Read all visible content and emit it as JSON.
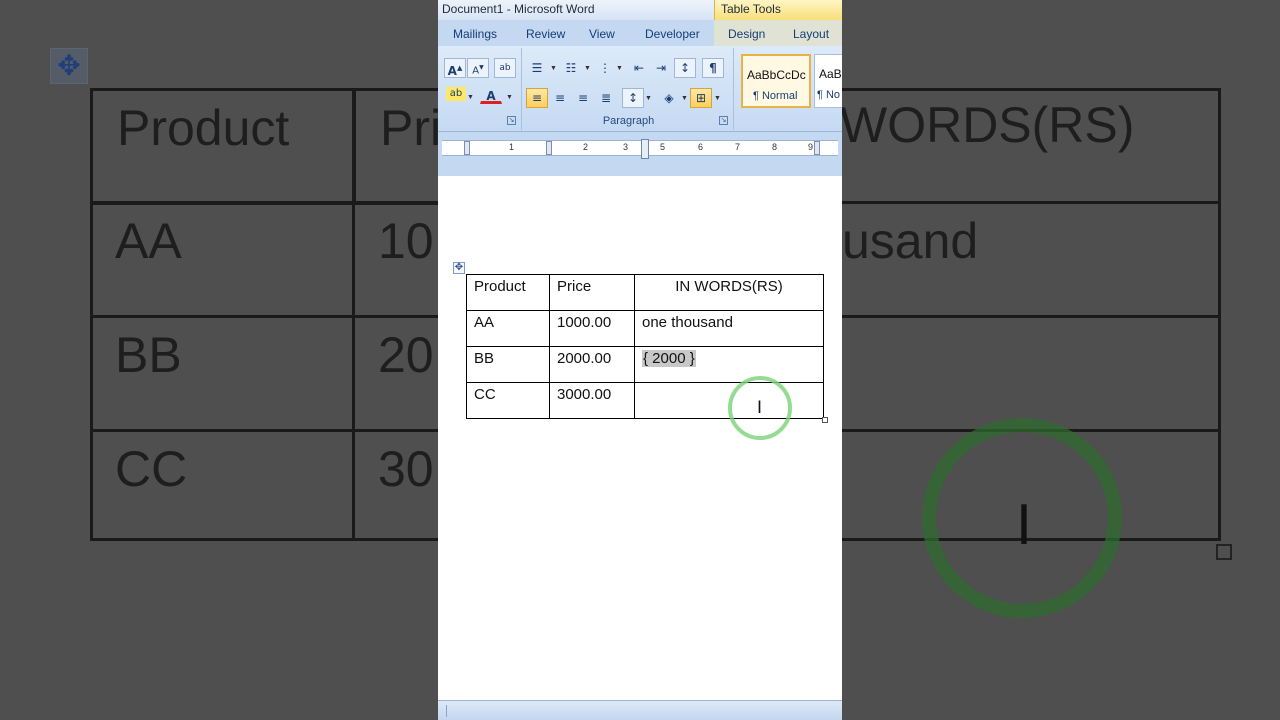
{
  "window": {
    "title": "Document1 - Microsoft Word",
    "context_label": "Table Tools"
  },
  "tabs": [
    {
      "label": "Mailings"
    },
    {
      "label": "Review"
    },
    {
      "label": "View"
    },
    {
      "label": "Developer"
    },
    {
      "label": "Design"
    },
    {
      "label": "Layout"
    }
  ],
  "ribbon": {
    "font_group": {
      "grow_font": "A",
      "shrink_font": "A",
      "clear_format": "ab",
      "highlight": "ab",
      "font_color": "A"
    },
    "paragraph_group": {
      "label": "Paragraph",
      "show_marks": "¶"
    },
    "styles": [
      {
        "sample": "AaBbCcDc",
        "name": "¶ Normal"
      },
      {
        "sample": "AaBl",
        "name": "¶ No"
      }
    ]
  },
  "ruler": {
    "numbers": [
      "1",
      "2",
      "3",
      "4",
      "5",
      "6",
      "7",
      "8",
      "9"
    ]
  },
  "table": {
    "headers": [
      "Product",
      "Price",
      "IN WORDS(RS)"
    ],
    "rows": [
      {
        "product": "AA",
        "price": "1000.00",
        "words": "one thousand"
      },
      {
        "product": "BB",
        "price": "2000.00",
        "words": "{ 2000 }"
      },
      {
        "product": "CC",
        "price": "3000.00",
        "words": ""
      }
    ]
  },
  "background_zoom": {
    "headers": [
      "Product",
      "Pri",
      "WORDS(RS)"
    ],
    "rows": [
      [
        "AA",
        "10",
        "usand"
      ],
      [
        "BB",
        "20",
        ""
      ],
      [
        "CC",
        "30",
        ""
      ]
    ]
  },
  "colors": {
    "ribbon": "#c4d8f1",
    "context_tab": "#f7df78",
    "click_ring": "#79d279",
    "field_shade": "#c8c8c8"
  }
}
